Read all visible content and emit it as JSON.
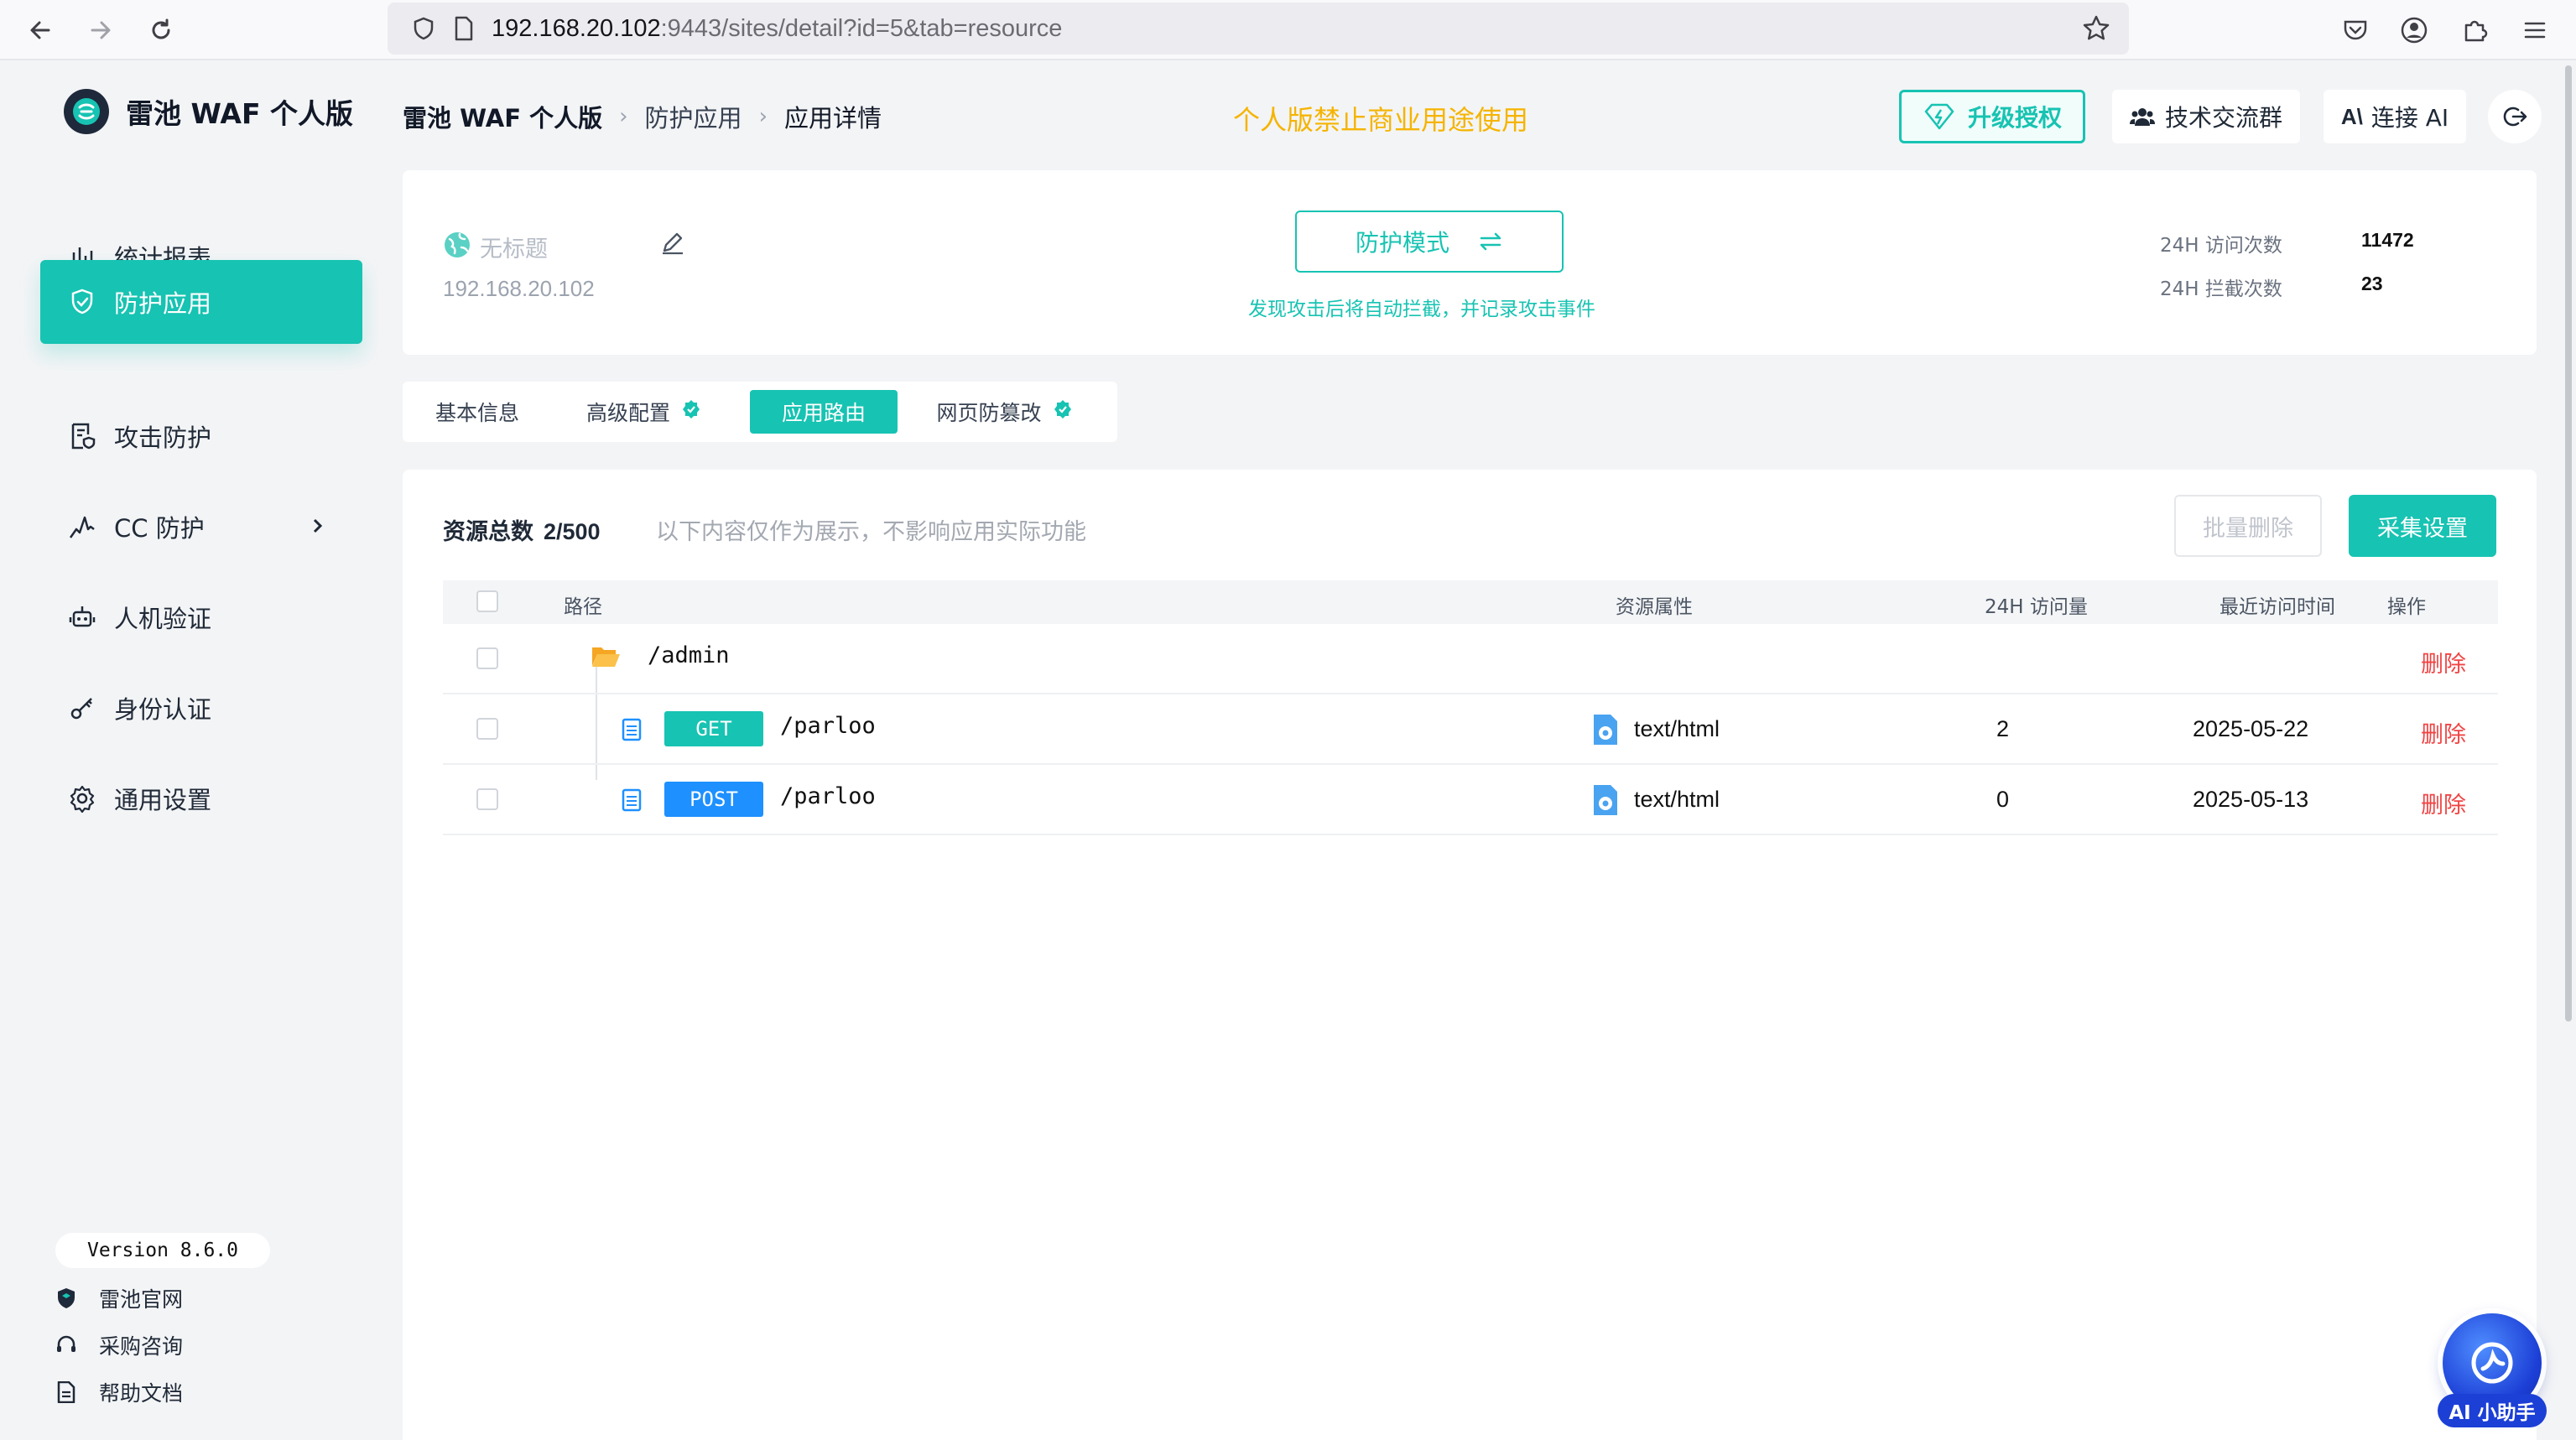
{
  "browser": {
    "url_host": "192.168.20.102",
    "url_rest": ":9443/sites/detail?id=5&tab=resource"
  },
  "sidebar": {
    "logo_text": "雷池 WAF 个人版",
    "items": [
      {
        "label": "统计报表",
        "icon": "bar-chart-icon"
      },
      {
        "label": "防护应用",
        "icon": "shield-icon",
        "active": true
      },
      {
        "label": "攻击防护",
        "icon": "document-shield-icon"
      },
      {
        "label": "CC 防护",
        "icon": "pulse-icon",
        "has_submenu": true
      },
      {
        "label": "人机验证",
        "icon": "robot-icon"
      },
      {
        "label": "身份认证",
        "icon": "key-icon"
      },
      {
        "label": "通用设置",
        "icon": "gear-icon"
      }
    ],
    "version": "Version 8.6.0",
    "footer_links": [
      {
        "label": "雷池官网",
        "icon": "shield-logo-icon"
      },
      {
        "label": "采购咨询",
        "icon": "headset-icon"
      },
      {
        "label": "帮助文档",
        "icon": "doc-icon"
      }
    ]
  },
  "header": {
    "breadcrumb": [
      "雷池 WAF 个人版",
      "防护应用",
      "应用详情"
    ],
    "notice": "个人版禁止商业用途使用",
    "upgrade_label": "升级授权",
    "community_label": "技术交流群",
    "ai_label": "连接 AI"
  },
  "site": {
    "title": "无标题",
    "ip": "192.168.20.102",
    "mode_label": "防护模式",
    "mode_desc": "发现攻击后将自动拦截，并记录攻击事件",
    "stats": [
      {
        "label": "24H 访问次数",
        "value": "11472"
      },
      {
        "label": "24H 拦截次数",
        "value": "23"
      }
    ]
  },
  "tabs": [
    {
      "label": "基本信息",
      "active": false
    },
    {
      "label": "高级配置",
      "active": false,
      "badge": "verified-icon"
    },
    {
      "label": "应用路由",
      "active": true
    },
    {
      "label": "网页防篡改",
      "active": false,
      "badge": "verified-icon"
    }
  ],
  "resources": {
    "total_label": "资源总数",
    "total_value": "2/500",
    "note": "以下内容仅作为展示，不影响应用实际功能",
    "bulk_delete_label": "批量删除",
    "collect_label": "采集设置",
    "columns": [
      "路径",
      "资源属性",
      "24H 访问量",
      "最近访问时间",
      "操作"
    ],
    "rows": [
      {
        "type": "folder",
        "path": "/admin",
        "action": "删除"
      },
      {
        "type": "file",
        "method": "GET",
        "path": "/parloo",
        "attr": "text/html",
        "visits": "2",
        "last": "2025-05-22",
        "action": "删除"
      },
      {
        "type": "file",
        "method": "POST",
        "path": "/parloo",
        "attr": "text/html",
        "visits": "0",
        "last": "2025-05-13",
        "action": "删除"
      }
    ]
  },
  "assistant": {
    "label": "AI 小助手"
  },
  "colors": {
    "accent": "#17c3b2",
    "notice": "#f5b400",
    "danger": "#f04444",
    "post": "#1e90ff"
  }
}
